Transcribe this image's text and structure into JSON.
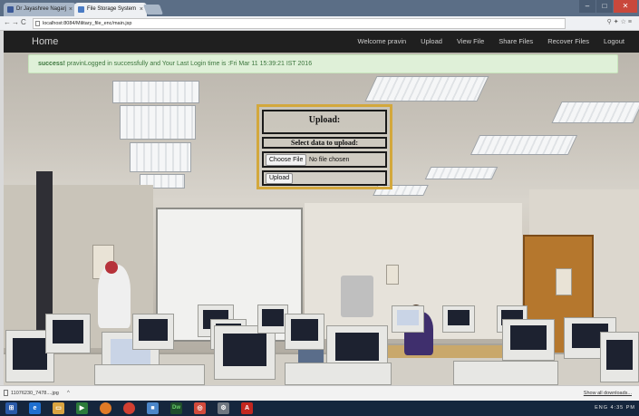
{
  "browser": {
    "tabs": [
      {
        "label": "Dr Jayashree Nagarj",
        "active": false
      },
      {
        "label": "File Storage System",
        "active": true
      }
    ],
    "url": "localhost:8084/Military_file_enc/main.jsp",
    "window_controls": [
      "minimize",
      "maximize",
      "close"
    ]
  },
  "navbar": {
    "brand": "Home",
    "links": [
      "Welcome pravin",
      "Upload",
      "View File",
      "Share Files",
      "Recover Files",
      "Logout"
    ]
  },
  "alert": {
    "strong": "success!",
    "message": " pravinLogged in successfully and Your Last Login time is :Fri Mar 11 15:39:21 IST 2016"
  },
  "upload_form": {
    "title": "Upload:",
    "select_label": "Select data to upload:",
    "choose_button": "Choose File",
    "file_status": "No file chosen",
    "upload_button": "Upload",
    "border_color": "#d3a83c"
  },
  "download_bar": {
    "item": "11076230_7478....jpg",
    "show_all": "Show all downloads..."
  },
  "taskbar": {
    "icons": [
      "windows-start",
      "internet-explorer",
      "file-explorer",
      "media",
      "firefox",
      "chrome",
      "box",
      "dreamweaver",
      "app",
      "settings",
      "acrobat"
    ],
    "tray_text": "ENG",
    "time": "4:35 PM"
  }
}
